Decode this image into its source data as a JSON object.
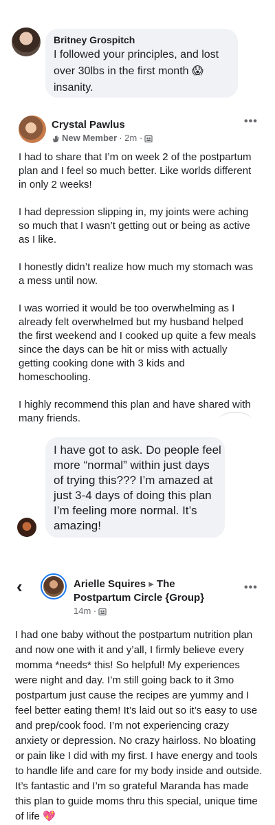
{
  "comment1": {
    "author": "Britney Grospitch",
    "text": "I followed your principles, and lost over 30lbs in the first month 😱 insanity."
  },
  "post1": {
    "author": "Crystal Pawlus",
    "badge": "New Member",
    "time": "· 2m ·",
    "more": "•••",
    "body": "I had to share that I’m on week 2 of the postpartum plan and I feel so much better. Like worlds different in only 2 weeks!\n\nI had depression slipping in, my joints were aching so much that I wasn’t getting out or being as active as I like.\n\nI honestly didn’t realize how much my stomach was a mess until now.\n\nI was worried it would be too overwhelming as I already felt overwhelmed but my husband helped the first weekend and I cooked up quite a few meals since the days can be hit or miss with actually getting cooking done with 3 kids and homeschooling.\n\nI highly recommend this plan and have shared with many friends."
  },
  "comment2": {
    "text": "I have got to ask. Do people feel more “normal” within just days of trying this??? I’m amazed at just 3-4 days of doing this plan I’m feeling more normal. It’s amazing!"
  },
  "post2": {
    "back": "‹",
    "author": "Arielle Squires",
    "arrow": "▸",
    "group": "The Postpartum Circle {Group}",
    "time": "14m ·",
    "more": "•••",
    "body": "I had one baby without the postpartum nutrition plan and now one with it and y’all, I firmly believe every momma *needs* this! So helpful! My experiences were night and day. I’m still going back to it 3mo postpartum just cause the recipes are yummy and I feel better eating them! It’s laid out so it’s easy to use and prep/cook food. I’m not experiencing crazy anxiety or depression. No crazy hairloss. No bloating or pain like I did with my first. I have energy and tools to handle life and care for my body inside and outside. It’s fantastic and I’m so grateful Maranda has made this plan to guide moms thru this special, unique time of life 💖"
  },
  "icons": {
    "audience": "members-icon",
    "badge": "waving-hand-icon"
  }
}
